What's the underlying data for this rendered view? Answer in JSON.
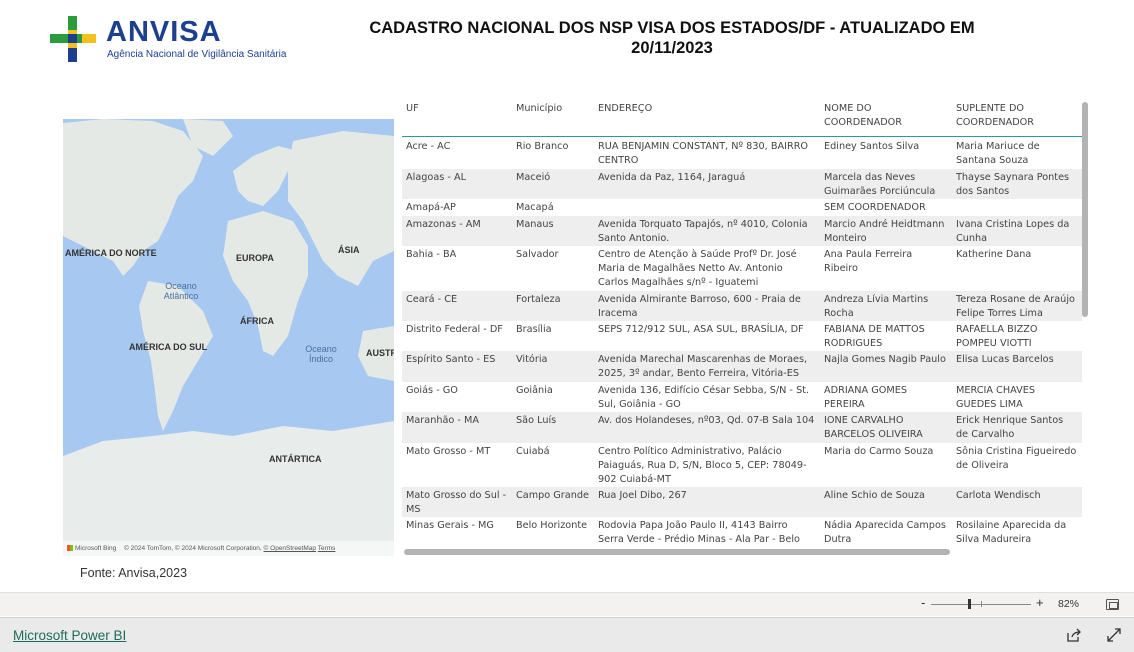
{
  "header": {
    "logo_text": "ANVISA",
    "logo_subtitle": "Agência Nacional de Vigilância Sanitária",
    "title_line1": "CADASTRO NACIONAL DOS NSP VISA DOS ESTADOS/DF - ATUALIZADO EM",
    "title_line2": "20/11/2023"
  },
  "map": {
    "labels": {
      "north_america": "AMÉRICA DO NORTE",
      "europe": "EUROPA",
      "asia": "ÁSIA",
      "africa": "ÁFRICA",
      "south_america": "AMÉRICA DO SUL",
      "australia": "AUSTR",
      "antarctica": "ANTÁRTICA",
      "atlantic_ocean": "Oceano Atlântico",
      "indian_ocean": "Oceano Índico"
    },
    "attribution": {
      "bing": "Microsoft Bing",
      "copyright": "© 2024 TomTom, © 2024 Microsoft Corporation",
      "osm": "© OpenStreetMap",
      "terms": "Terms"
    }
  },
  "table": {
    "columns": [
      "UF",
      "Município",
      "ENDEREÇO",
      "NOME DO COORDENADOR",
      "SUPLENTE DO COORDENADOR"
    ],
    "rows": [
      {
        "uf": "Acre - AC",
        "municipio": "Rio Branco",
        "endereco": "RUA BENJAMIN CONSTANT, Nº 830, BAIRRO CENTRO",
        "coordenador": "Ediney Santos Silva",
        "suplente": "Maria Mariuce de Santana Souza"
      },
      {
        "uf": "Alagoas - AL",
        "municipio": "Maceió",
        "endereco": "Avenida da Paz, 1164, Jaraguá",
        "coordenador": "Marcela das Neves Guimarães Porciúncula",
        "suplente": "Thayse Saynara Pontes dos Santos"
      },
      {
        "uf": "Amapá-AP",
        "municipio": "Macapá",
        "endereco": "",
        "coordenador": "SEM COORDENADOR",
        "suplente": ""
      },
      {
        "uf": "Amazonas - AM",
        "municipio": "Manaus",
        "endereco": "Avenida Torquato Tapajós, nº 4010, Colonia Santo Antonio.",
        "coordenador": "Marcio André Heidtmann Monteiro",
        "suplente": "Ivana Cristina Lopes da Cunha"
      },
      {
        "uf": "Bahia - BA",
        "municipio": "Salvador",
        "endereco": "Centro de Atenção à Saúde Profº Dr. José Maria de Magalhães Netto Av. Antonio Carlos Magalhães s/nº - Iguatemi",
        "coordenador": "Ana Paula Ferreira Ribeiro",
        "suplente": "Katherine Dana"
      },
      {
        "uf": "Ceará - CE",
        "municipio": "Fortaleza",
        "endereco": "Avenida Almirante Barroso, 600 - Praia de Iracema",
        "coordenador": "Andreza Lívia Martins Rocha",
        "suplente": "Tereza Rosane de Araújo Felipe Torres Lima"
      },
      {
        "uf": "Distrito Federal - DF",
        "municipio": "Brasília",
        "endereco": "SEPS 712/912 SUL, ASA SUL, BRASÍLIA, DF",
        "coordenador": "FABIANA DE MATTOS RODRIGUES",
        "suplente": "RAFAELLA BIZZO POMPEU VIOTTI"
      },
      {
        "uf": "Espírito Santo - ES",
        "municipio": "Vitória",
        "endereco": "Avenida Marechal Mascarenhas de Moraes, 2025, 3º andar, Bento Ferreira, Vitória-ES",
        "coordenador": "Najla Gomes Nagib Paulo",
        "suplente": "Elisa Lucas Barcelos"
      },
      {
        "uf": "Goiás - GO",
        "municipio": "Goiânia",
        "endereco": "Avenida 136, Edifício César Sebba, S/N - St. Sul, Goiânia - GO",
        "coordenador": "ADRIANA GOMES PEREIRA",
        "suplente": "MERCIA CHAVES GUEDES LIMA"
      },
      {
        "uf": "Maranhão - MA",
        "municipio": "São Luís",
        "endereco": "Av. dos Holandeses, nº03, Qd. 07-B Sala 104",
        "coordenador": "IONE CARVALHO BARCELOS OLIVEIRA",
        "suplente": "Erick Henrique Santos de Carvalho"
      },
      {
        "uf": "Mato Grosso - MT",
        "municipio": "Cuiabá",
        "endereco": "Centro Político Administrativo, Palácio Paiaguás, Rua D, S/N, Bloco 5, CEP: 78049-902 Cuiabá-MT",
        "coordenador": "Maria do Carmo Souza",
        "suplente": "Sônia Cristina Figueiredo de Oliveira"
      },
      {
        "uf": "Mato Grosso do Sul - MS",
        "municipio": "Campo Grande",
        "endereco": "Rua Joel Dibo, 267",
        "coordenador": "Aline Schio de Souza",
        "suplente": "Carlota Wendisch"
      },
      {
        "uf": "Minas Gerais - MG",
        "municipio": "Belo Horizonte",
        "endereco": "Rodovia Papa João Paulo II, 4143 Bairro Serra Verde - Prédio Minas - Ala Par - Belo",
        "coordenador": "Nádia Aparecida Campos Dutra",
        "suplente": "Rosilaine Aparecida da Silva Madureira"
      }
    ]
  },
  "source_note": "Fonte: Anvisa,2023",
  "zoom": {
    "minus": "-",
    "plus": "+",
    "value": "82%"
  },
  "footer": {
    "powerbi_link": "Microsoft Power BI"
  }
}
